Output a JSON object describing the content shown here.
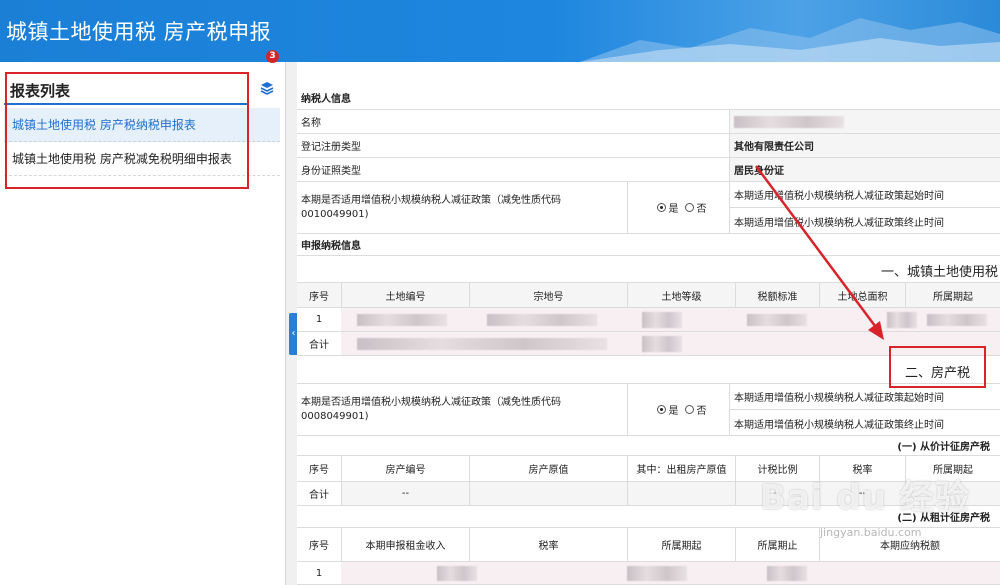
{
  "header": {
    "title": "城镇土地使用税 房产税申报"
  },
  "sidebar": {
    "title": "报表列表",
    "badge": "3",
    "items": [
      {
        "label": "城镇土地使用税 房产税纳税申报表"
      },
      {
        "label": "城镇土地使用税 房产税减免税明细申报表"
      }
    ]
  },
  "taxpayer": {
    "section": "纳税人信息",
    "name_label": "名称",
    "reg_type_label": "登记注册类型",
    "reg_type_value": "其他有限责任公司",
    "id_type_label": "身份证照类型",
    "id_type_value": "居民身份证",
    "policy_label": "本期是否适用增值税小规模纳税人减征政策（减免性质代码0010049901)",
    "yes": "是",
    "no": "否",
    "start_label": "本期适用增值税小规模纳税人减征政策起始时间",
    "end_label": "本期适用增值税小规模纳税人减征政策终止时间"
  },
  "declare": {
    "section": "申报纳税信息"
  },
  "land": {
    "title": "一、城镇土地使用税",
    "headers": [
      "序号",
      "土地编号",
      "宗地号",
      "土地等级",
      "税额标准",
      "土地总面积",
      "所属期起"
    ],
    "row1": "1",
    "total": "合计"
  },
  "property": {
    "title": "二、房产税",
    "policy_label": "本期是否适用增值税小规模纳税人减征政策（减免性质代码0008049901)",
    "yes": "是",
    "no": "否",
    "start_label": "本期适用增值税小规模纳税人减征政策起始时间",
    "end_label": "本期适用增值税小规模纳税人减征政策终止时间",
    "sub1": "(一) 从价计征房产税",
    "headers1": [
      "序号",
      "房产编号",
      "房产原值",
      "其中：出租房产原值",
      "计税比例",
      "税率",
      "所属期起"
    ],
    "total": "合计",
    "dash": "--",
    "sub2": "(二) 从租计征房产税",
    "headers2": [
      "序号",
      "本期申报租金收入",
      "税率",
      "所属期起",
      "所属期止",
      "本期应纳税额"
    ],
    "row1": "1"
  },
  "watermark": {
    "text": "Bai du 经验",
    "sub": "jingyan.baidu.com"
  }
}
